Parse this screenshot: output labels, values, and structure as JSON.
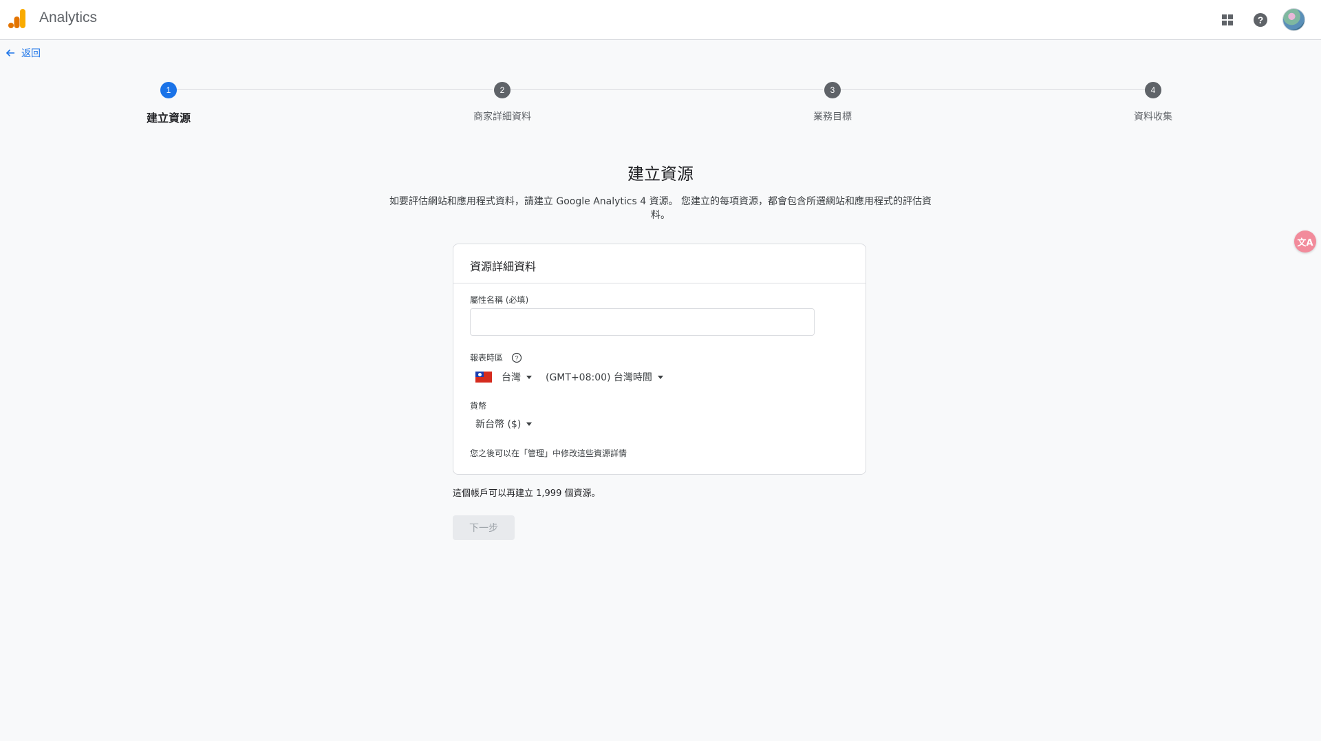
{
  "app": {
    "title": "Analytics"
  },
  "nav": {
    "back_label": "返回"
  },
  "stepper": {
    "steps": [
      {
        "number": "1",
        "label": "建立資源",
        "state": "active"
      },
      {
        "number": "2",
        "label": "商家詳細資料",
        "state": "inactive"
      },
      {
        "number": "3",
        "label": "業務目標",
        "state": "inactive"
      },
      {
        "number": "4",
        "label": "資料收集",
        "state": "inactive"
      }
    ]
  },
  "page": {
    "heading": "建立資源",
    "description": "如要評估網站和應用程式資料，請建立 Google Analytics 4 資源。 您建立的每項資源，都會包含所選網站和應用程式的評估資料。"
  },
  "card": {
    "title": "資源詳細資料",
    "property_name_label": "屬性名稱 (必填)",
    "property_name_value": "",
    "timezone_label": "報表時區",
    "country_value": "台灣",
    "timezone_value": "(GMT+08:00) 台灣時間",
    "currency_label": "貨幣",
    "currency_value": "新台幣 ($)",
    "note": "您之後可以在「管理」中修改這些資源詳情"
  },
  "quota_text": "這個帳戶可以再建立 1,999 個資源。",
  "next_button_label": "下一步",
  "translate_fab_label": "文A",
  "icons": {
    "logo": "analytics-logo-icon",
    "apps": "apps-grid-icon",
    "help": "help-icon",
    "back": "arrow-back-icon",
    "flag": "taiwan-flag-icon",
    "translate": "translate-icon"
  },
  "colors": {
    "accent": "#1a73e8",
    "logo_orange": "#f9ab00",
    "logo_dark_orange": "#e37400",
    "disabled_button": "#e8eaed"
  }
}
